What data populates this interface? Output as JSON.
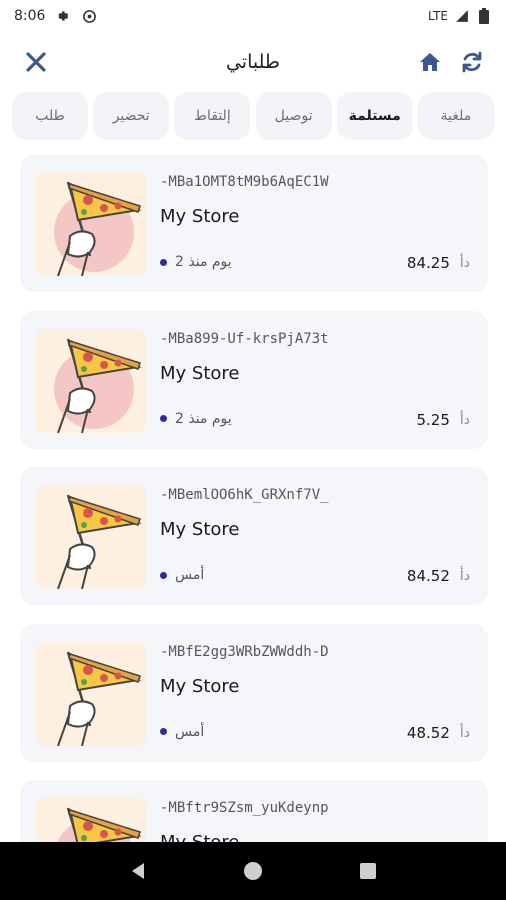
{
  "status_bar": {
    "time": "8:06",
    "network": "LTE",
    "icons": [
      "gear-icon",
      "vpn-icon",
      "signal-icon",
      "battery-icon"
    ]
  },
  "header": {
    "title": "طلباتي",
    "icons": {
      "refresh": "refresh-icon",
      "home": "home-icon",
      "close": "close-icon"
    }
  },
  "tabs": [
    {
      "label": "ملغية",
      "active": false
    },
    {
      "label": "مستلمة",
      "active": true
    },
    {
      "label": "توصيل",
      "active": false
    },
    {
      "label": "إلتقاط",
      "active": false
    },
    {
      "label": "تحضير",
      "active": false
    },
    {
      "label": "طلب",
      "active": false
    }
  ],
  "orders": [
    {
      "id": "-MBa1OMT8tM9b6AqEC1W",
      "store": "My Store",
      "time": "2 يوم منذ",
      "currency": "دأ",
      "price": "84.25"
    },
    {
      "id": "-MBa899-Uf-krsPjA73t",
      "store": "My Store",
      "time": "2 يوم منذ",
      "currency": "دأ",
      "price": "5.25"
    },
    {
      "id": "-MBemlOO6hK_GRXnf7V_",
      "store": "My Store",
      "time": "أمس",
      "currency": "دأ",
      "price": "84.52"
    },
    {
      "id": "-MBfE2gg3WRbZWWddh-D",
      "store": "My Store",
      "time": "أمس",
      "currency": "دأ",
      "price": "48.52"
    },
    {
      "id": "-MBftr9SZsm_yuKdeynp",
      "store": "My Store",
      "time": "",
      "currency": "",
      "price": ""
    }
  ],
  "colors": {
    "accent_dot": "#2d2aa0",
    "card_bg": "#f5f6fa",
    "thumb_bg": "#fdf0e0",
    "thumb_circle": "#f4c6c6",
    "icon_blue": "#3a5a8c"
  },
  "nav_bar": {
    "icons": [
      "back-icon",
      "home-circle-icon",
      "recents-icon"
    ]
  }
}
